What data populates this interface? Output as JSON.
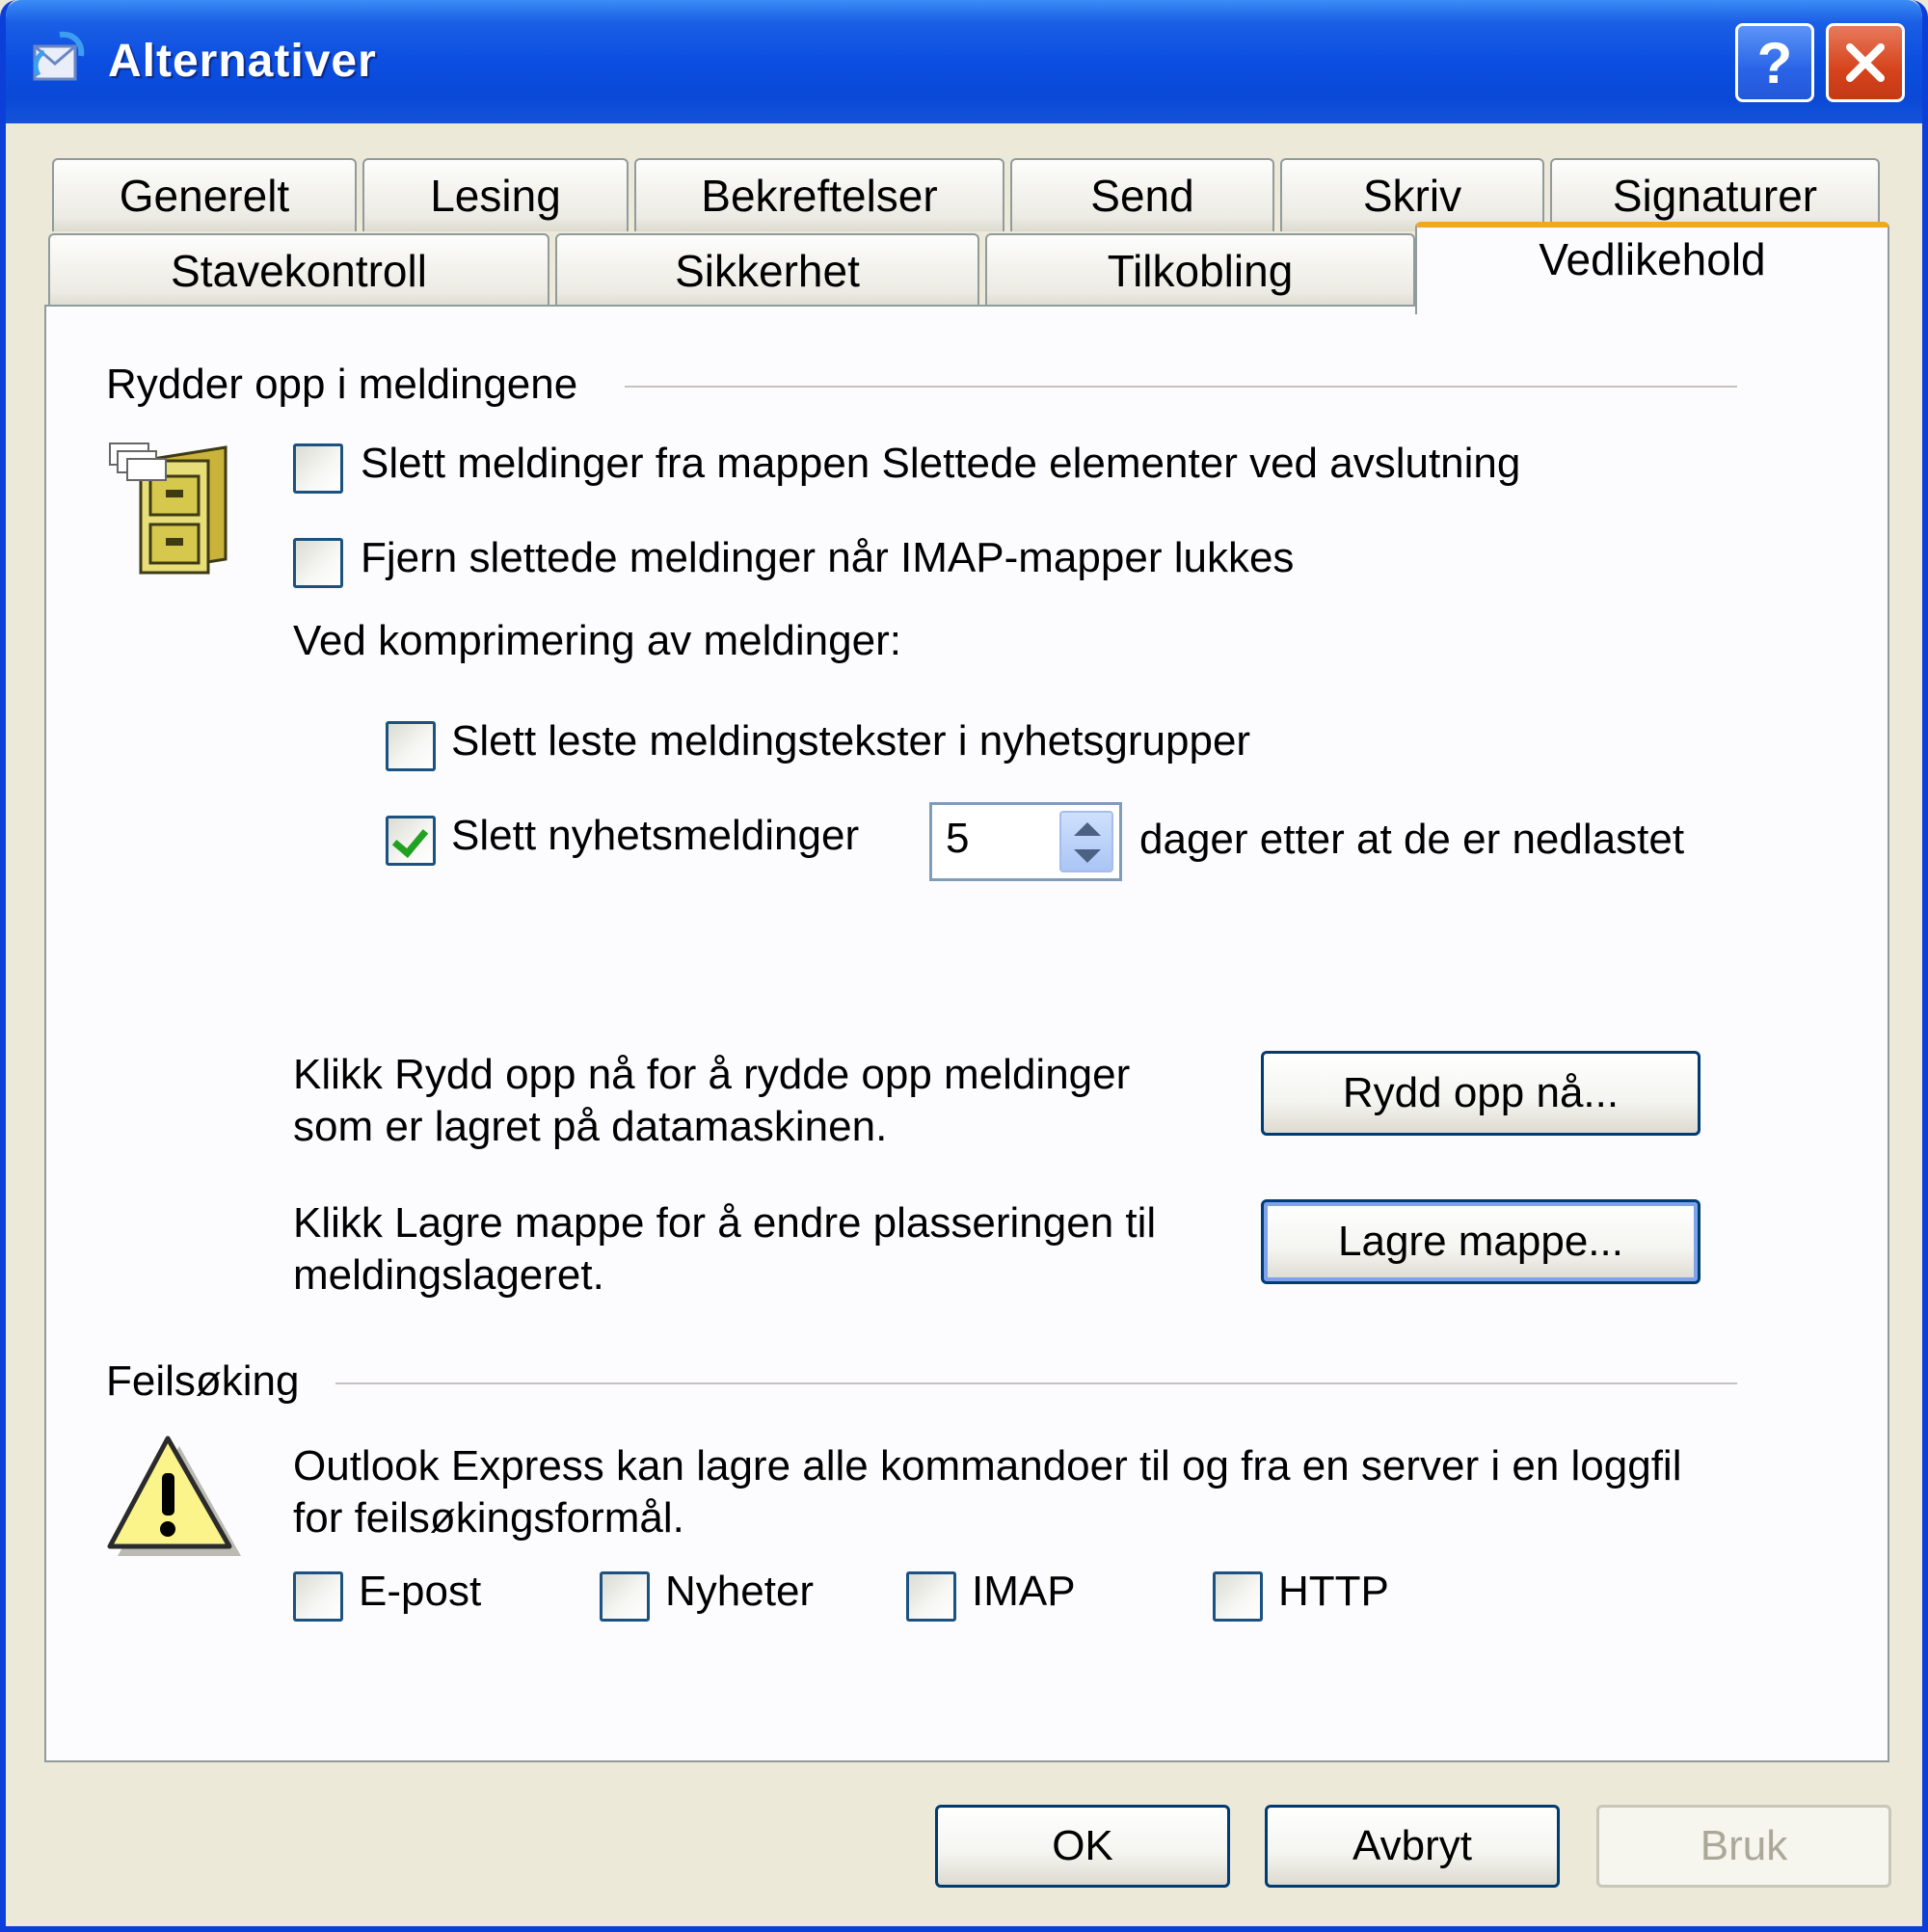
{
  "window": {
    "title": "Alternativer"
  },
  "tabs_row1": [
    "Generelt",
    "Lesing",
    "Bekreftelser",
    "Send",
    "Skriv",
    "Signaturer"
  ],
  "tabs_row2": [
    "Stavekontroll",
    "Sikkerhet",
    "Tilkobling",
    "Vedlikehold"
  ],
  "active_tab": "Vedlikehold",
  "cleanup": {
    "group_label": "Rydder opp i meldingene",
    "empty_deleted_label": "Slett meldinger fra mappen Slettede elementer ved avslutning",
    "empty_deleted_checked": false,
    "purge_imap_label": "Fjern slettede meldinger når IMAP-mapper lukkes",
    "purge_imap_checked": false,
    "compact_label": "Ved komprimering av meldinger:",
    "delete_read_bodies_label": "Slett leste meldingstekster i nyhetsgrupper",
    "delete_read_bodies_checked": false,
    "delete_news_label": "Slett nyhetsmeldinger",
    "delete_news_checked": true,
    "delete_news_days": "5",
    "delete_news_suffix": "dager etter at de er nedlastet",
    "clean_up_text_line1": "Klikk Rydd opp nå for å rydde opp meldinger",
    "clean_up_text_line2": "som er lagret på datamaskinen.",
    "clean_up_button": "Rydd opp nå...",
    "store_text_line1": "Klikk Lagre mappe for å endre plasseringen til",
    "store_text_line2": "meldingslageret.",
    "store_button": "Lagre mappe..."
  },
  "troubleshooting": {
    "group_label": "Feilsøking",
    "text_line1": "Outlook Express kan lagre alle kommandoer til og fra en server i en loggfil",
    "text_line2": "for feilsøkingsformål.",
    "options": [
      {
        "label": "E-post",
        "checked": false
      },
      {
        "label": "Nyheter",
        "checked": false
      },
      {
        "label": "IMAP",
        "checked": false
      },
      {
        "label": "HTTP",
        "checked": false
      }
    ]
  },
  "footer": {
    "ok": "OK",
    "cancel": "Avbryt",
    "apply": "Bruk"
  },
  "colors": {
    "titlebar": "#0a49d6",
    "active_tab_accent": "#f3a622",
    "checkmark": "#21a121",
    "dialog_bg": "#ece9d8"
  }
}
